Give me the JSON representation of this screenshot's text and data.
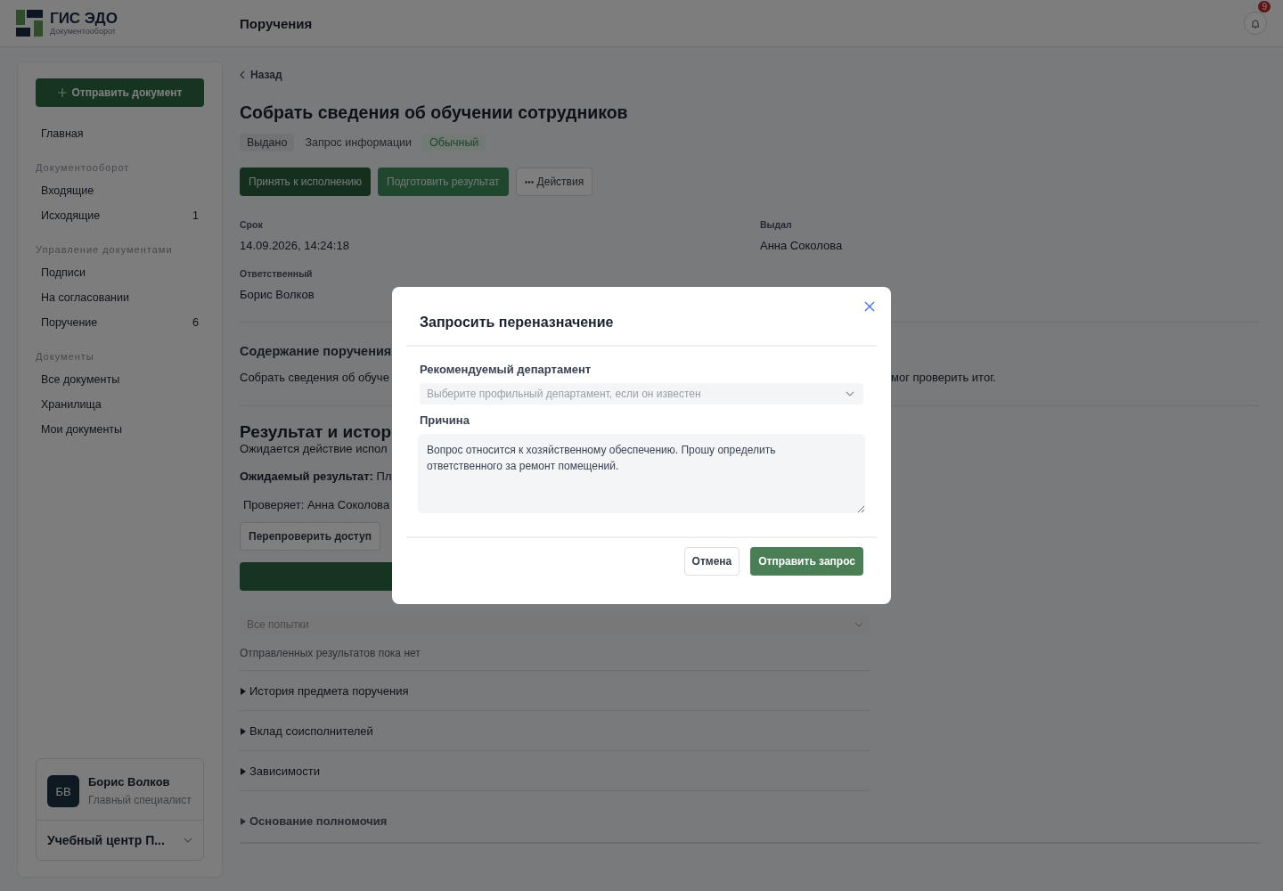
{
  "app": {
    "name": "ГИС ЭДО",
    "subtitle": "Документооборот"
  },
  "header": {
    "title": "Поручения",
    "notifications": "9"
  },
  "sidebar": {
    "primary_button": "Отправить документ",
    "top_items": [
      {
        "label": "Главная",
        "selected": false
      }
    ],
    "sections": [
      {
        "title": "Документооборот",
        "items": [
          {
            "label": "Входящие",
            "selected": false
          },
          {
            "label": "Исходящие",
            "count": "1",
            "selected": false
          }
        ]
      },
      {
        "title": "Управление документами",
        "items": [
          {
            "label": "Подписи",
            "selected": false
          },
          {
            "label": "На согласовании",
            "selected": false
          },
          {
            "label": "Поручение",
            "count": "6",
            "selected": false
          }
        ]
      },
      {
        "title": "Документы",
        "items": [
          {
            "label": "Все документы",
            "selected": false
          },
          {
            "label": "Хранилища",
            "selected": false
          },
          {
            "label": "Мои документы",
            "selected": false
          }
        ]
      }
    ],
    "user": {
      "initials": "БВ",
      "name": "Борис Волков",
      "role": "Главный специалист",
      "organization": "Учебный центр П..."
    }
  },
  "main": {
    "back": "Назад",
    "title": "Собрать сведения об обучении сотрудников",
    "tags": [
      {
        "text": "Выдано",
        "kind": "status"
      },
      {
        "text": "Запрос информации",
        "kind": "plain"
      },
      {
        "text": "Обычный",
        "kind": "priority"
      }
    ],
    "actions": [
      {
        "label": "Принять к исполнению",
        "kind": "primary"
      },
      {
        "label": "Подготовить результат",
        "kind": "secondary"
      },
      {
        "label": "Действия",
        "kind": "menu"
      }
    ],
    "fields": [
      {
        "label": "Срок",
        "value": "14.09.2026, 14:24:18"
      },
      {
        "label": "Выдал",
        "value": "Анна Соколова"
      },
      {
        "label": "Ответственный",
        "value": "Борис Волков"
      }
    ],
    "content": {
      "title": "Содержание поручения",
      "text_start": "Собрать сведения об обуче",
      "text_end": "мог проверить итог."
    },
    "result": {
      "title": "Результат и истор",
      "status": "Ожидается действие испол",
      "expected": "**Ожидаемый результат:** Пл",
      "reviewer": "Проверяет: Анна Соколова",
      "recheck_button": "Перепроверить доступ"
    },
    "attempts": {
      "placeholder": "Все попытки"
    },
    "empty_text": "Отправленных результатов пока нет",
    "sections": [
      {
        "label": "История предмета поручения",
        "kind": "summary",
        "expanded": false
      },
      {
        "label": "Вклад соисполнителей",
        "kind": "summary",
        "expanded": false
      },
      {
        "label": "Зависимости",
        "kind": "summary",
        "expanded": false
      },
      {
        "label": "Основание полномочия",
        "kind": "heading",
        "expanded": false
      }
    ]
  },
  "modal": {
    "title": "Запросить переназначение",
    "department": {
      "label": "Рекомендуемый департамент",
      "placeholder": "Выберите профильный департамент, если он известен"
    },
    "reason": {
      "label": "Причина",
      "value": "Вопрос относится к хозяйственному обеспечению. Прошу определить ответственного за ремонт помещений."
    },
    "buttons": [
      {
        "label": "Отмена",
        "kind": "secondary"
      },
      {
        "label": "Отправить запрос",
        "kind": "primary"
      }
    ]
  }
}
